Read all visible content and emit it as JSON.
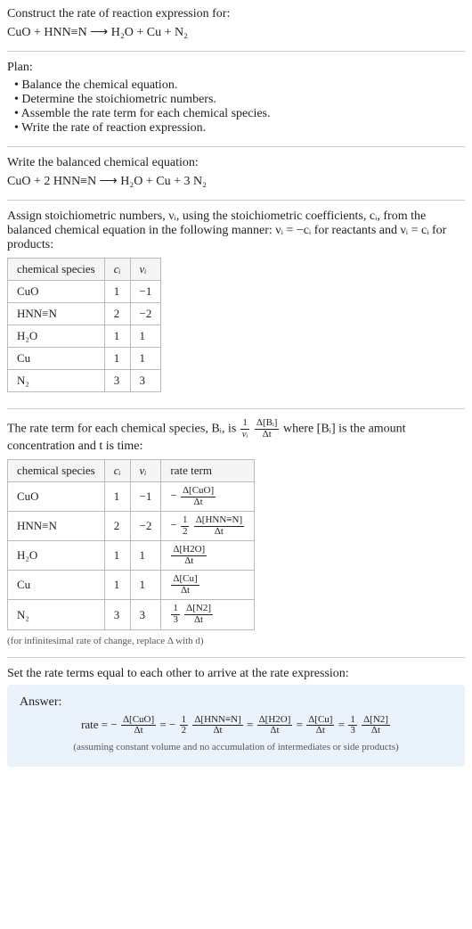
{
  "header": {
    "prompt": "Construct the rate of reaction expression for:",
    "equation": "CuO + HNN≡N  ⟶  H₂O + Cu + N₂"
  },
  "plan": {
    "heading": "Plan:",
    "items": [
      "• Balance the chemical equation.",
      "• Determine the stoichiometric numbers.",
      "• Assemble the rate term for each chemical species.",
      "• Write the rate of reaction expression."
    ]
  },
  "balanced": {
    "heading": "Write the balanced chemical equation:",
    "equation": "CuO + 2 HNN≡N  ⟶  H₂O + Cu + 3 N₂"
  },
  "stoich": {
    "intro": "Assign stoichiometric numbers, νᵢ, using the stoichiometric coefficients, cᵢ, from the balanced chemical equation in the following manner: νᵢ = −cᵢ for reactants and νᵢ = cᵢ for products:",
    "headers": [
      "chemical species",
      "cᵢ",
      "νᵢ"
    ],
    "rows": [
      {
        "species": "CuO",
        "c": "1",
        "v": "−1"
      },
      {
        "species": "HNN≡N",
        "c": "2",
        "v": "−2"
      },
      {
        "species": "H₂O",
        "c": "1",
        "v": "1"
      },
      {
        "species": "Cu",
        "c": "1",
        "v": "1"
      },
      {
        "species": "N₂",
        "c": "3",
        "v": "3"
      }
    ]
  },
  "rateterm": {
    "intro_pre": "The rate term for each chemical species, Bᵢ, is ",
    "intro_post": " where [Bᵢ] is the amount concentration and t is time:",
    "frac1": {
      "num": "1",
      "den": "νᵢ"
    },
    "frac2": {
      "num": "Δ[Bᵢ]",
      "den": "Δt"
    },
    "headers": [
      "chemical species",
      "cᵢ",
      "νᵢ",
      "rate term"
    ],
    "rows": [
      {
        "species": "CuO",
        "c": "1",
        "v": "−1",
        "pre": "−",
        "coef_num": "",
        "coef_den": "",
        "num": "Δ[CuO]",
        "den": "Δt"
      },
      {
        "species": "HNN≡N",
        "c": "2",
        "v": "−2",
        "pre": "−",
        "coef_num": "1",
        "coef_den": "2",
        "num": "Δ[HNN≡N]",
        "den": "Δt"
      },
      {
        "species": "H₂O",
        "c": "1",
        "v": "1",
        "pre": "",
        "coef_num": "",
        "coef_den": "",
        "num": "Δ[H2O]",
        "den": "Δt"
      },
      {
        "species": "Cu",
        "c": "1",
        "v": "1",
        "pre": "",
        "coef_num": "",
        "coef_den": "",
        "num": "Δ[Cu]",
        "den": "Δt"
      },
      {
        "species": "N₂",
        "c": "3",
        "v": "3",
        "pre": "",
        "coef_num": "1",
        "coef_den": "3",
        "num": "Δ[N2]",
        "den": "Δt"
      }
    ],
    "note": "(for infinitesimal rate of change, replace Δ with d)"
  },
  "final": {
    "heading": "Set the rate terms equal to each other to arrive at the rate expression:",
    "answer_label": "Answer:",
    "rate_label": "rate = ",
    "eq_sign": " = ",
    "terms": [
      {
        "pre": "−",
        "coef_num": "",
        "coef_den": "",
        "num": "Δ[CuO]",
        "den": "Δt"
      },
      {
        "pre": "−",
        "coef_num": "1",
        "coef_den": "2",
        "num": "Δ[HNN≡N]",
        "den": "Δt"
      },
      {
        "pre": "",
        "coef_num": "",
        "coef_den": "",
        "num": "Δ[H2O]",
        "den": "Δt"
      },
      {
        "pre": "",
        "coef_num": "",
        "coef_den": "",
        "num": "Δ[Cu]",
        "den": "Δt"
      },
      {
        "pre": "",
        "coef_num": "1",
        "coef_den": "3",
        "num": "Δ[N2]",
        "den": "Δt"
      }
    ],
    "note": "(assuming constant volume and no accumulation of intermediates or side products)"
  }
}
